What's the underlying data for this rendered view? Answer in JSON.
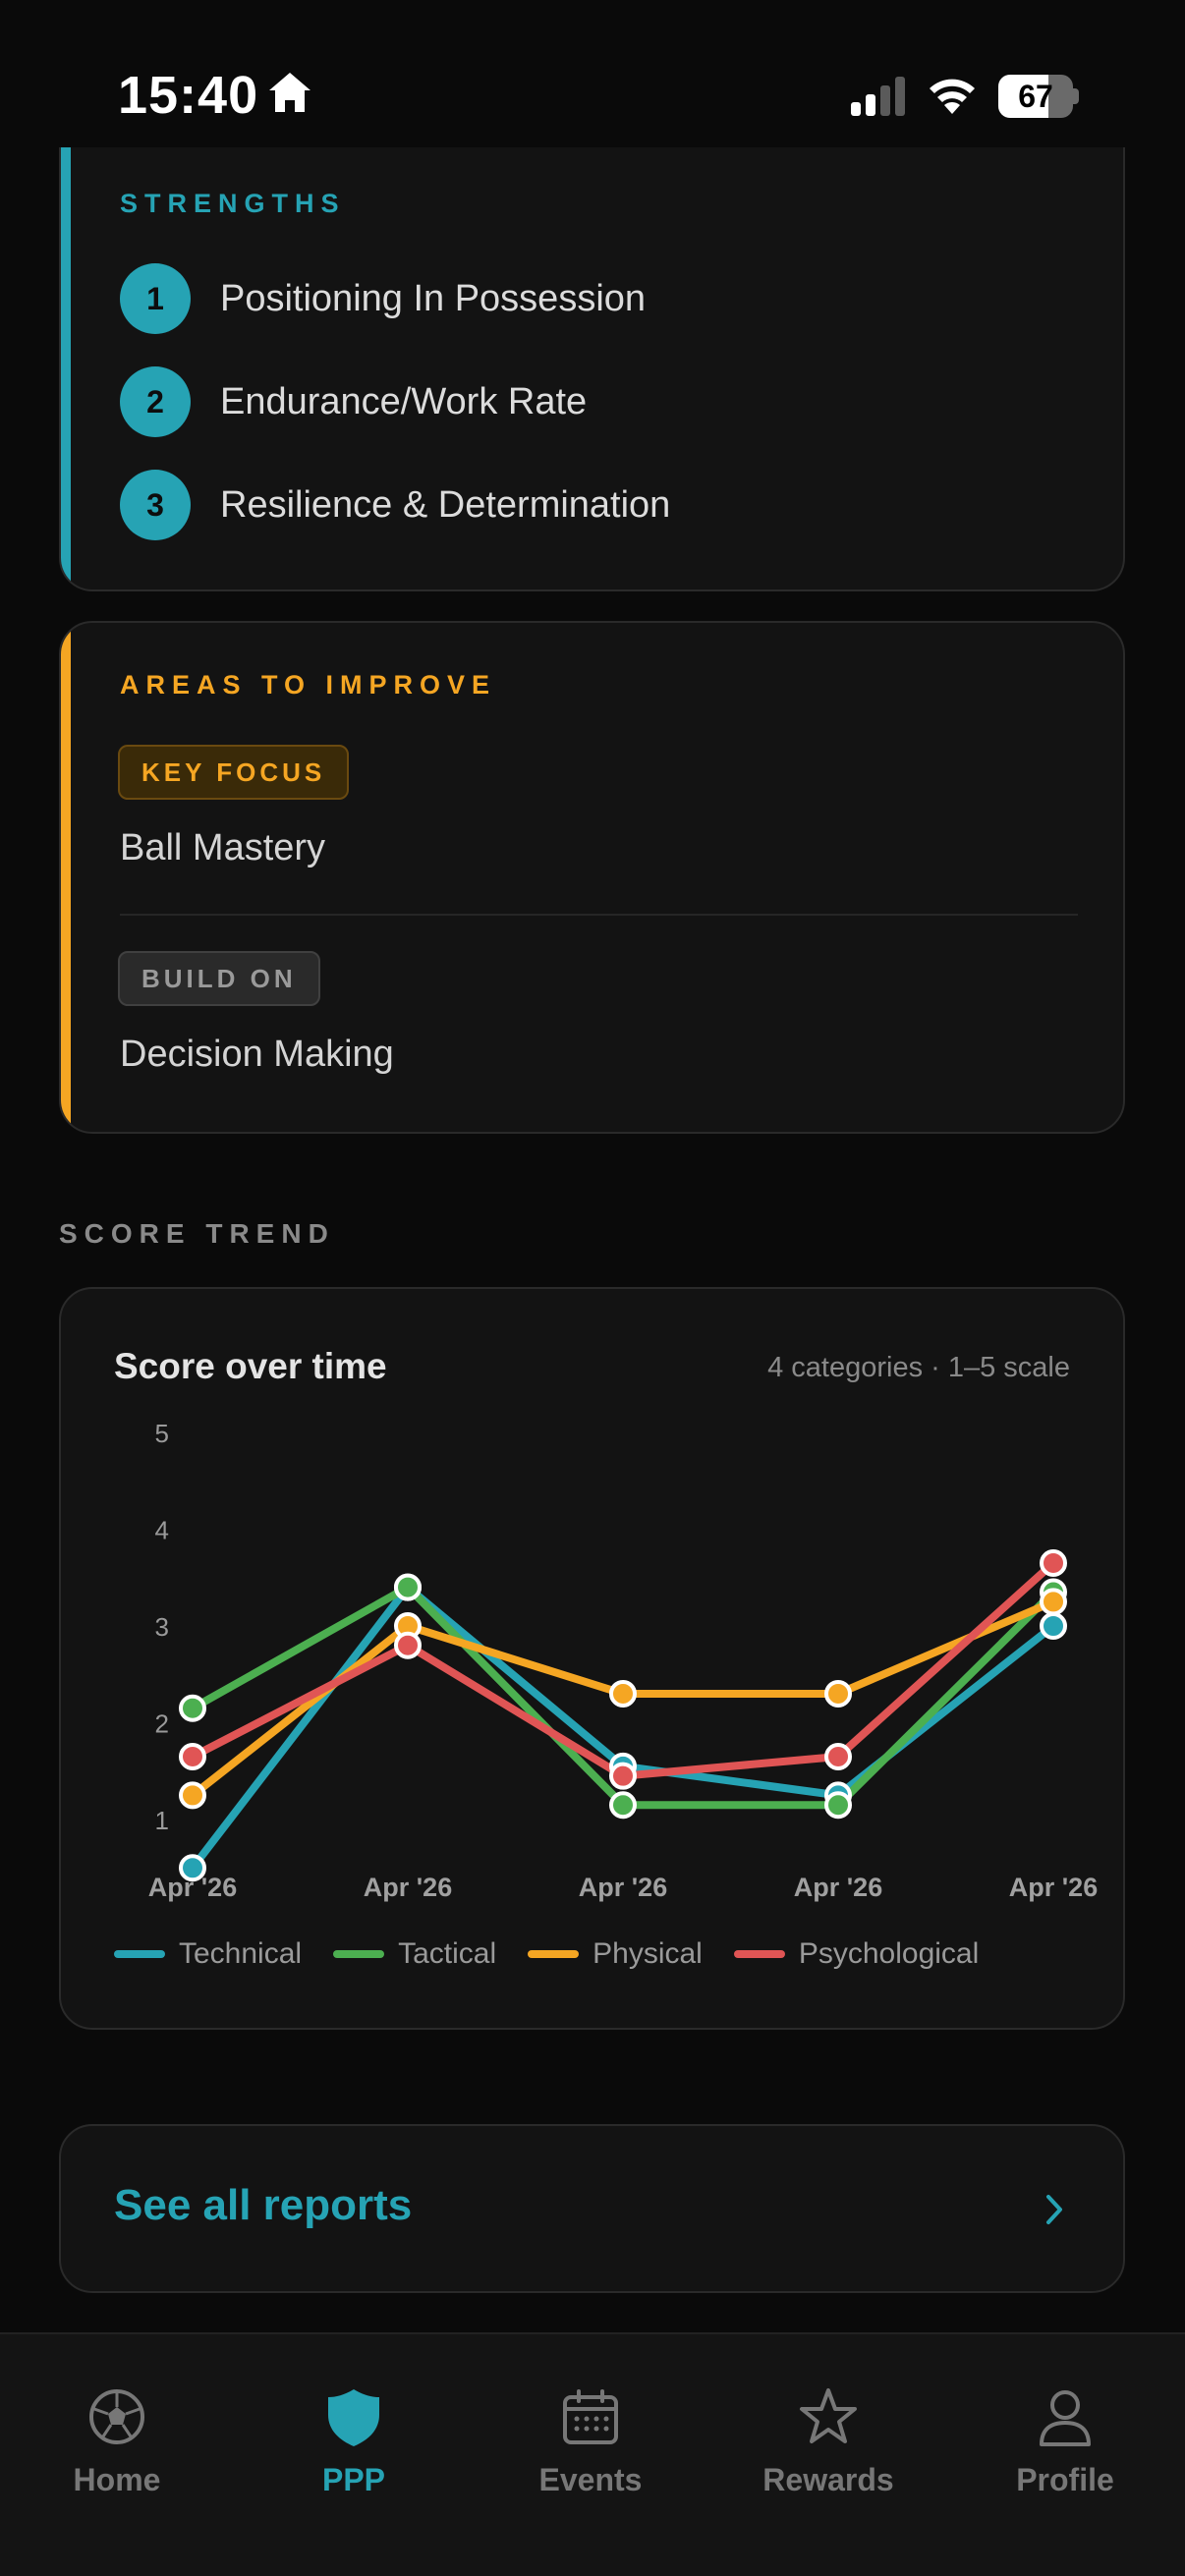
{
  "status": {
    "time": "15:40",
    "battery": "67",
    "battery_level": 0.67
  },
  "strengths": {
    "label": "STRENGTHS",
    "accent": "#26a3b4",
    "items": [
      {
        "num": "1",
        "text": "Positioning In Possession"
      },
      {
        "num": "2",
        "text": "Endurance/Work Rate"
      },
      {
        "num": "3",
        "text": "Resilience & Determination"
      }
    ]
  },
  "improve": {
    "label": "AREAS TO IMPROVE",
    "accent": "#f5a623",
    "key_badge": "KEY FOCUS",
    "key_item": "Ball Mastery",
    "build_badge": "BUILD ON",
    "build_item": "Decision Making"
  },
  "trend": {
    "label": "SCORE TREND"
  },
  "chart_data": {
    "type": "line",
    "title": "Score over time",
    "subtitle": "4 categories · 1–5 scale",
    "categories": [
      "Apr '26",
      "Apr '26",
      "Apr '26",
      "Apr '26",
      "Apr '26"
    ],
    "yticks": [
      1,
      2,
      3,
      4,
      5
    ],
    "ylim": [
      0.5,
      5
    ],
    "grid": false,
    "legend": "bottom",
    "series": [
      {
        "name": "Technical",
        "color": "#26a3b4",
        "values": [
          0.5,
          3.4,
          1.55,
          1.25,
          3.0
        ]
      },
      {
        "name": "Tactical",
        "color": "#4caf50",
        "values": [
          2.15,
          3.4,
          1.15,
          1.15,
          3.35
        ]
      },
      {
        "name": "Physical",
        "color": "#f5a623",
        "values": [
          1.25,
          3.0,
          2.3,
          2.3,
          3.25
        ]
      },
      {
        "name": "Psychological",
        "color": "#e05555",
        "values": [
          1.65,
          2.8,
          1.45,
          1.65,
          3.65
        ]
      }
    ]
  },
  "see_all": {
    "label": "See all reports"
  },
  "tabs": [
    {
      "label": "Home",
      "icon": "soccer-ball-icon"
    },
    {
      "label": "PPP",
      "icon": "shield-icon"
    },
    {
      "label": "Events",
      "icon": "calendar-icon"
    },
    {
      "label": "Rewards",
      "icon": "star-icon"
    },
    {
      "label": "Profile",
      "icon": "person-icon"
    }
  ]
}
